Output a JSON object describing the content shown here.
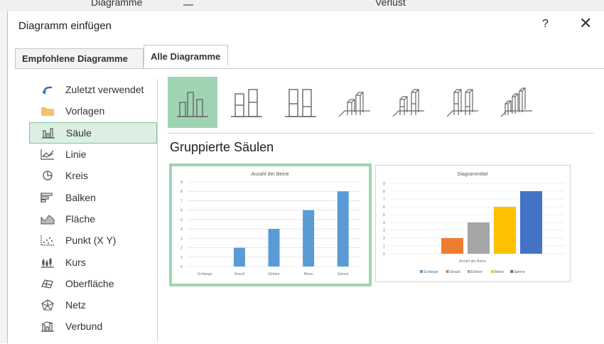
{
  "background": {
    "word1": "Diagramme",
    "word2": "Verlust"
  },
  "dialog": {
    "title": "Diagramm einfügen",
    "help": "?",
    "close": "✕"
  },
  "tabs": [
    {
      "label": "Empfohlene Diagramme"
    },
    {
      "label": "Alle Diagramme"
    }
  ],
  "categories": [
    {
      "label": "Zuletzt verwendet",
      "icon": "undo-arrow-icon"
    },
    {
      "label": "Vorlagen",
      "icon": "folder-icon"
    },
    {
      "label": "Säule",
      "icon": "column-chart-icon"
    },
    {
      "label": "Linie",
      "icon": "line-chart-icon"
    },
    {
      "label": "Kreis",
      "icon": "pie-chart-icon"
    },
    {
      "label": "Balken",
      "icon": "bar-chart-icon"
    },
    {
      "label": "Fläche",
      "icon": "area-chart-icon"
    },
    {
      "label": "Punkt (X Y)",
      "icon": "scatter-chart-icon"
    },
    {
      "label": "Kurs",
      "icon": "stock-chart-icon"
    },
    {
      "label": "Oberfläche",
      "icon": "surface-chart-icon"
    },
    {
      "label": "Netz",
      "icon": "radar-chart-icon"
    },
    {
      "label": "Verbund",
      "icon": "combo-chart-icon"
    }
  ],
  "selected_category": "Säule",
  "subtype_title": "Gruppierte Säulen",
  "colors": {
    "accent": "#9fd4b3",
    "accent_light": "#dcefe2",
    "bar_blue": "#5b9bd5",
    "orange": "#ed7d31",
    "gray": "#a5a5a5",
    "gold": "#ffc000",
    "blue2": "#4472c4"
  },
  "chart_data": [
    {
      "type": "bar",
      "title": "Anzahl der Beine",
      "categories": [
        "Schlange",
        "Strauß",
        "Elefant",
        "Biene",
        "Spinne"
      ],
      "values": [
        0,
        2,
        4,
        6,
        8
      ],
      "ylim": [
        0,
        9
      ],
      "grid": true
    },
    {
      "type": "bar",
      "title": "Diagrammtitel",
      "xlabel": "Anzahl der Beine",
      "series": [
        {
          "name": "Schlange",
          "values": [
            0
          ]
        },
        {
          "name": "Strauß",
          "values": [
            2
          ]
        },
        {
          "name": "Elefant",
          "values": [
            4
          ]
        },
        {
          "name": "Biene",
          "values": [
            6
          ]
        },
        {
          "name": "Spinne",
          "values": [
            8
          ]
        }
      ],
      "ylim": [
        0,
        9
      ],
      "grid": true,
      "legend": "bottom"
    }
  ]
}
